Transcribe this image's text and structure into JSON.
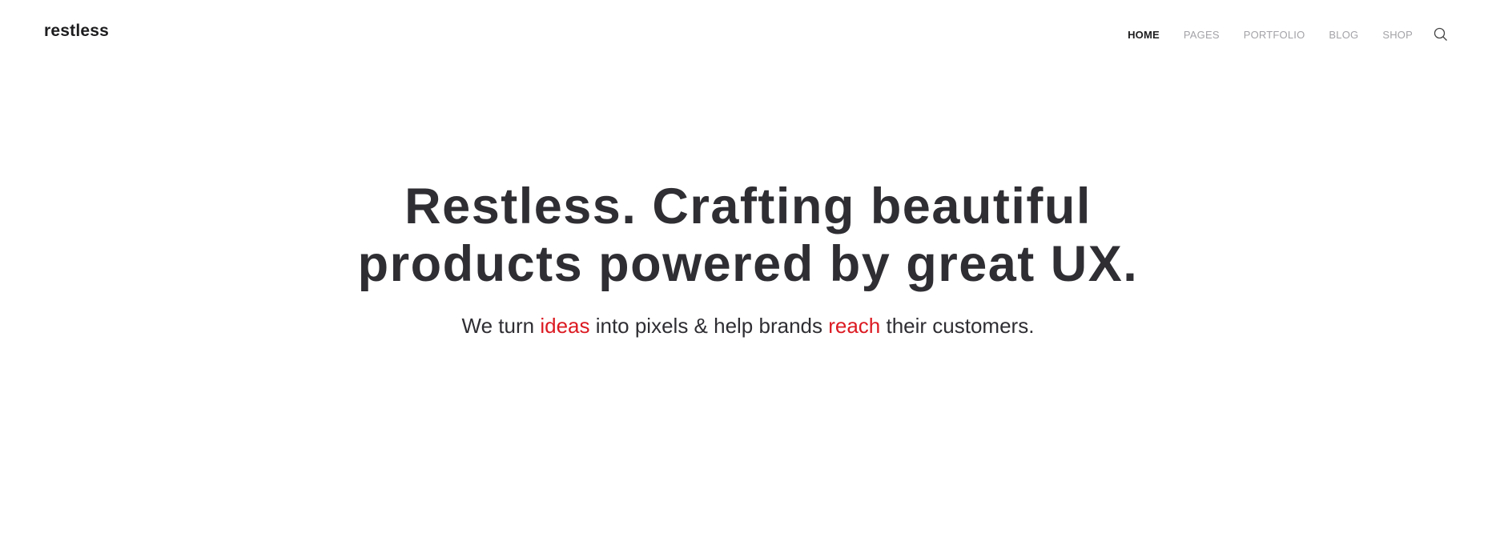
{
  "header": {
    "logo": "restless",
    "nav": [
      {
        "label": "HOME"
      },
      {
        "label": "PAGES"
      },
      {
        "label": "PORTFOLIO"
      },
      {
        "label": "BLOG"
      },
      {
        "label": "SHOP"
      }
    ],
    "search_icon": "search-icon"
  },
  "hero": {
    "line1": "Restless. Crafting beautiful",
    "line2": "products powered by great UX.",
    "sub": {
      "p1": "We turn ",
      "h1": "ideas",
      "p2": " into pixels & help brands ",
      "h2": "reach",
      "p3": " their customers."
    }
  },
  "colors": {
    "accent": "#dc1a22",
    "text": "#2e2e33",
    "nav_inactive": "#a3a3a8"
  }
}
